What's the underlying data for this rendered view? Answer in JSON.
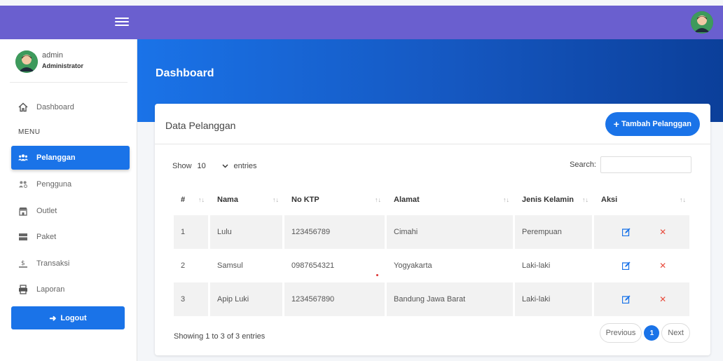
{
  "topbar": {
    "menu_icon": "hamburger-icon",
    "avatar_icon": "user-avatar-icon",
    "color": "#6a5fcf"
  },
  "user": {
    "name": "admin",
    "role": "Administrator"
  },
  "sidebar": {
    "dashboard": {
      "label": "Dashboard",
      "icon": "home-icon"
    },
    "menu_label": "MENU",
    "items": [
      {
        "label": "Pelanggan",
        "icon": "users-icon",
        "active": true
      },
      {
        "label": "Pengguna",
        "icon": "user-group-icon",
        "active": false
      },
      {
        "label": "Outlet",
        "icon": "store-icon",
        "active": false
      },
      {
        "label": "Paket",
        "icon": "package-icon",
        "active": false
      },
      {
        "label": "Transaksi",
        "icon": "dolly-icon",
        "active": false
      },
      {
        "label": "Laporan",
        "icon": "print-icon",
        "active": false
      }
    ],
    "logout_label": "Logout"
  },
  "header": {
    "title": "Dashboard"
  },
  "card": {
    "title": "Data Pelanggan",
    "add_button": "Tambah Pelanggan",
    "show_label": "Show",
    "entries_value": "10",
    "entries_label": "entries",
    "search_label": "Search:",
    "search_value": "",
    "columns": [
      "#",
      "Nama",
      "No KTP",
      "Alamat",
      "Jenis Kelamin",
      "Aksi"
    ],
    "rows": [
      {
        "no": "1",
        "nama": "Lulu",
        "ktp": "123456789",
        "alamat": "Cimahi",
        "jk": "Perempuan"
      },
      {
        "no": "2",
        "nama": "Samsul",
        "ktp": "0987654321",
        "alamat": "Yogyakarta",
        "jk": "Laki-laki"
      },
      {
        "no": "3",
        "nama": "Apip Luki",
        "ktp": "1234567890",
        "alamat": "Bandung Jawa Barat",
        "jk": "Laki-laki"
      }
    ],
    "info": "Showing 1 to 3 of 3 entries",
    "pagination": {
      "previous": "Previous",
      "current": "1",
      "next": "Next"
    }
  },
  "colors": {
    "primary": "#1a73e8",
    "danger": "#e84c3d",
    "topbar": "#6a5fcf"
  }
}
